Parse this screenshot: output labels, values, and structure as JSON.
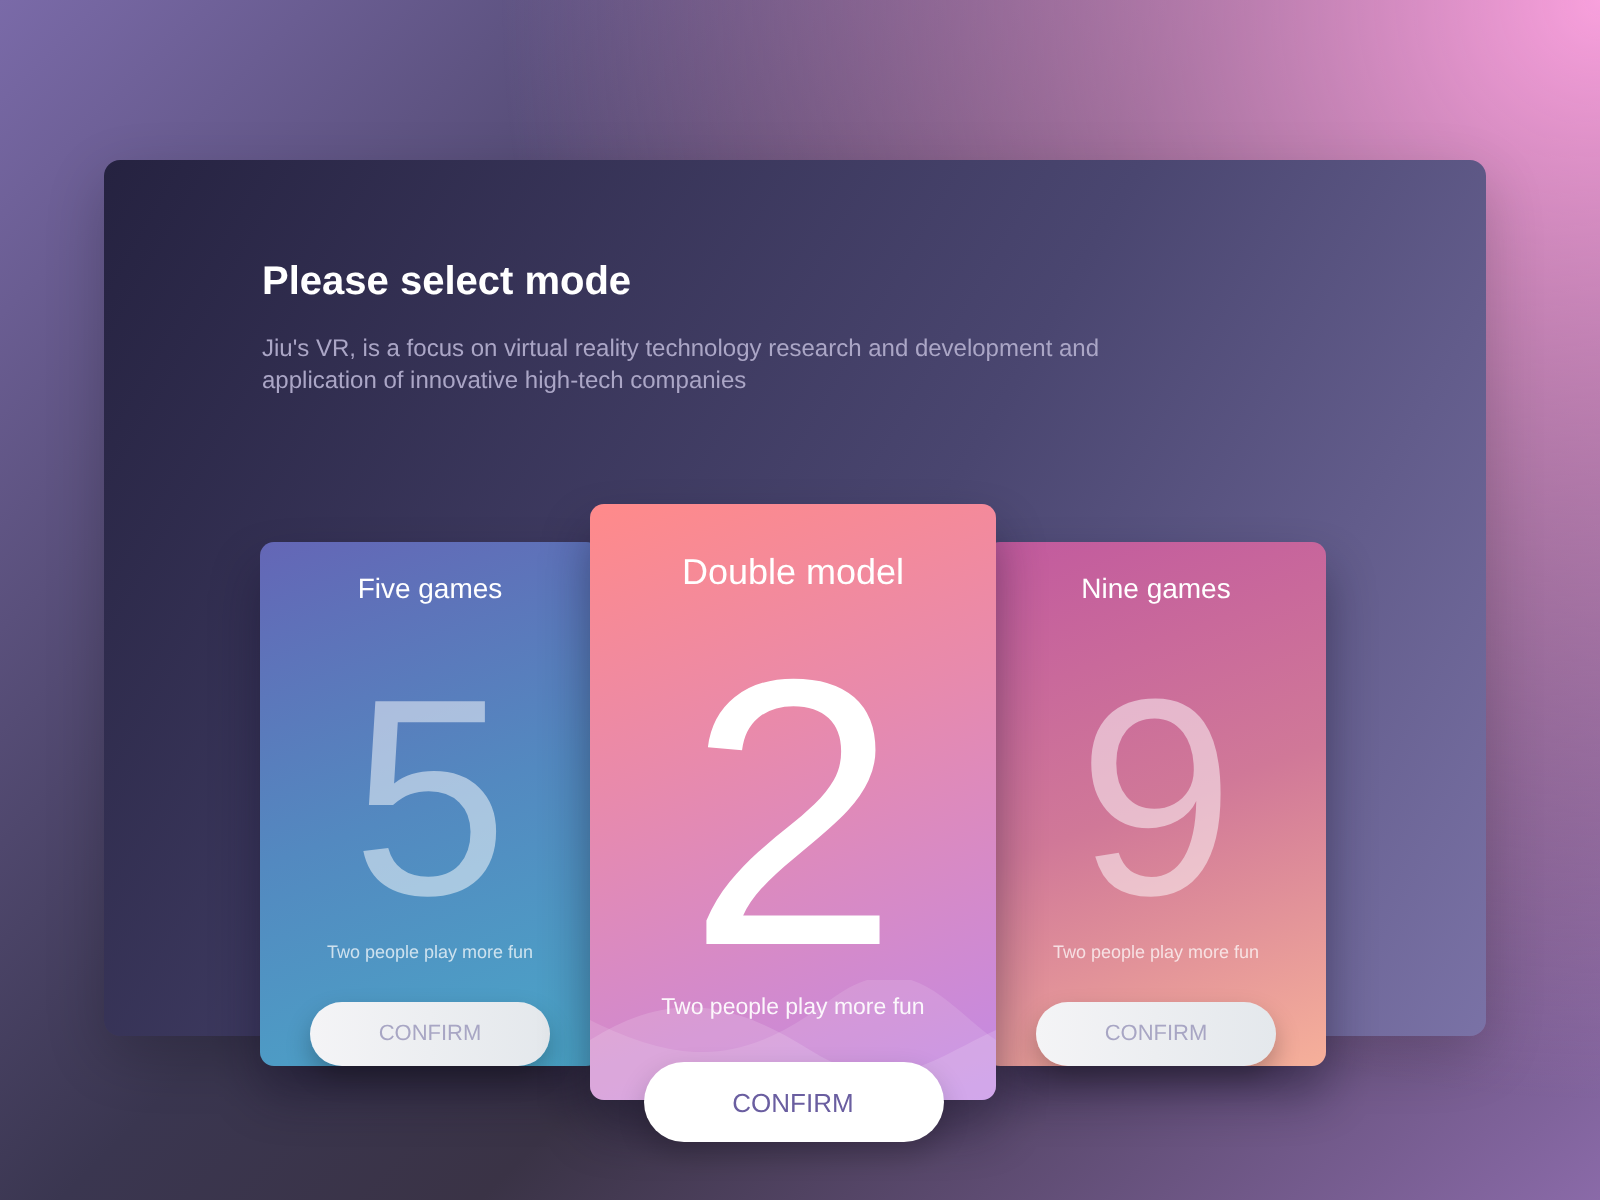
{
  "header": {
    "title": "Please select mode",
    "description": "Jiu's VR, is a focus on virtual reality technology research and development and application of innovative high-tech companies"
  },
  "modes": [
    {
      "title": "Five games",
      "digit": "5",
      "tagline": "Two people play more fun",
      "button": "CONFIRM",
      "selected": false
    },
    {
      "title": "Double model",
      "digit": "2",
      "tagline": "Two people play more fun",
      "button": "CONFIRM",
      "selected": true
    },
    {
      "title": "Nine games",
      "digit": "9",
      "tagline": "Two people play more fun",
      "button": "CONFIRM",
      "selected": false
    }
  ]
}
